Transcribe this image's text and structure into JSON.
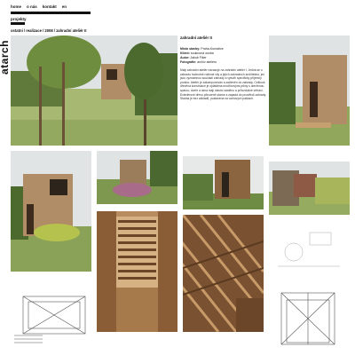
{
  "brand": {
    "logo_text": "atarch"
  },
  "nav": {
    "items": [
      "home",
      "o nás",
      "kontakt",
      "en"
    ],
    "sub": "projekty",
    "breadcrumb": "ostatní / realizace / 2008 / zahradní ateliér II"
  },
  "project": {
    "title": "zahradní ateliér II",
    "meta": [
      {
        "label": "Místo stavby:",
        "value": "Praha-Kunratice"
      },
      {
        "label": "Klient:",
        "value": "soukromá osoba"
      },
      {
        "label": "Autor:",
        "value": "Jakub Fišer"
      },
      {
        "label": "Fotografie:",
        "value": "archiv ateliéru"
      }
    ],
    "description": "Malý zahradní ateliér navazuje na zahradní ateliér I. Jedná se o zahradu hodnotné rodinné vily a jejích zahradních architektur, jež jsou významnou součástí zahrady a vytváří specifický příjemný prostor. Ateliér je zakomponován a začleněn do zahrady. Celková dřevěná konstrukce je opláštěna modřínovými prkny s otevřenou spárou; dveře a okna mají vlastní zástěnu a průvzdušné větrání. Exteriérové dřevo přirozeně stárne a zapadá do prostředí zahrady. Stavba je bez základů, postavena na ocelových patkách."
  },
  "colors": {
    "ink": "#111111",
    "wood": "#a88560",
    "wood_dark": "#6e4a2b",
    "grass": "#8da55a"
  }
}
